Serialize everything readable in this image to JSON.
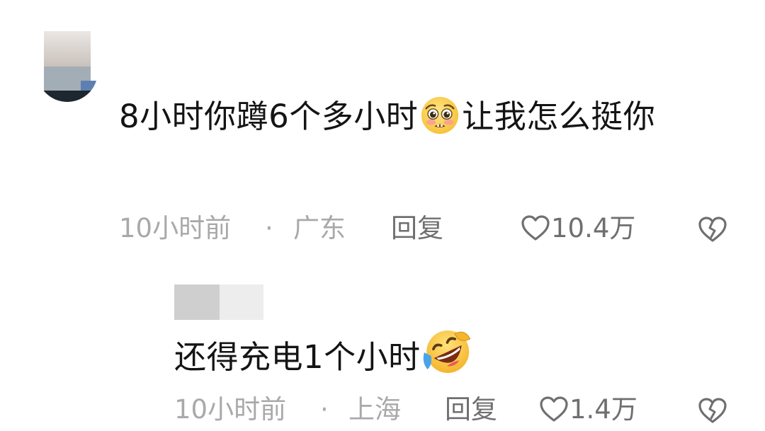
{
  "comment": {
    "text_part1": "8小时你蹲6个多小时",
    "emoji": "pleading-face-emoji",
    "text_part2": "让我怎么挺你",
    "time": "10小时前",
    "separator": "·",
    "location": "广东",
    "reply_label": "回复",
    "like_count": "10.4万"
  },
  "reply": {
    "text": "还得充电1个小时",
    "emoji": "rolling-on-floor-laughing-emoji",
    "time": "10小时前",
    "separator": "·",
    "location": "上海",
    "reply_label": "回复",
    "like_count": "1.4万"
  },
  "colors": {
    "primary_text": "#141414",
    "meta_text": "#a9a9a9",
    "action_text": "#6f6f6f",
    "background": "#ffffff"
  },
  "icons": [
    "heart-icon",
    "broken-heart-icon"
  ]
}
